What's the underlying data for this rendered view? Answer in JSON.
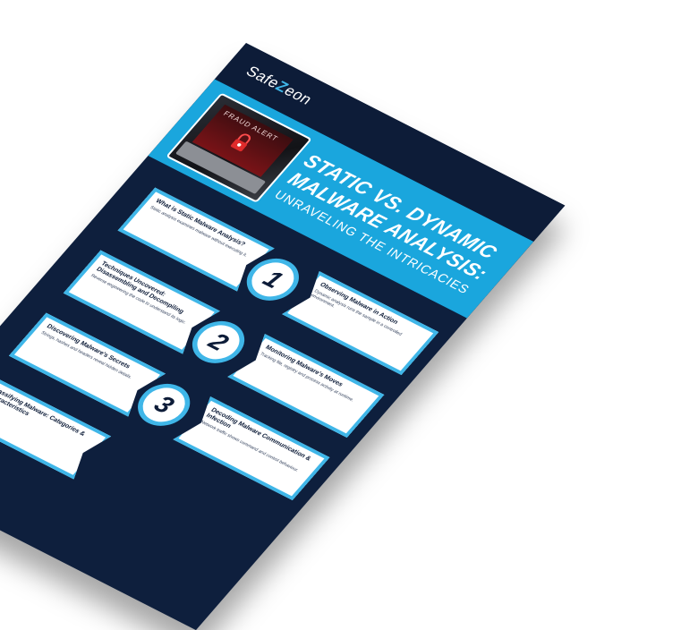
{
  "logo": {
    "left": "Safe",
    "mark": "Z",
    "right": "eon"
  },
  "hero": {
    "screen_text": "FRAUD ALERT",
    "title_line1": "STATIC VS. DYNAMIC",
    "title_line2": "MALWARE ANALYSIS:",
    "subtitle": "UNRAVELING THE INTRICACIES"
  },
  "steps": [
    {
      "number": "1"
    },
    {
      "number": "2"
    },
    {
      "number": "3"
    }
  ],
  "boxes": {
    "what_is_static": {
      "title": "What is Static Malware Analysis?",
      "text": "Static analysis examines malware without executing it."
    },
    "observing": {
      "title": "Observing Malware in Action",
      "text": "Dynamic analysis runs the sample in a controlled environment."
    },
    "techniques": {
      "title": "Techniques Uncovered: Disassembling and Decompiling",
      "text": "Reverse engineering the code to understand its logic."
    },
    "monitoring": {
      "title": "Monitoring Malware's Moves",
      "text": "Tracking file, registry and process activity at runtime."
    },
    "discovering": {
      "title": "Discovering Malware's Secrets",
      "text": "Strings, hashes and headers reveal hidden details."
    },
    "decoding": {
      "title": "Decoding Malware Communication & Infection",
      "text": "Network traffic shows command and control behaviour."
    },
    "classifying": {
      "title": "Classifying Malware: Categories & Characteristics",
      "text": ""
    }
  },
  "colors": {
    "navy": "#0e1f3d",
    "cyan": "#1aa6dd",
    "border": "#3fb6e8"
  }
}
